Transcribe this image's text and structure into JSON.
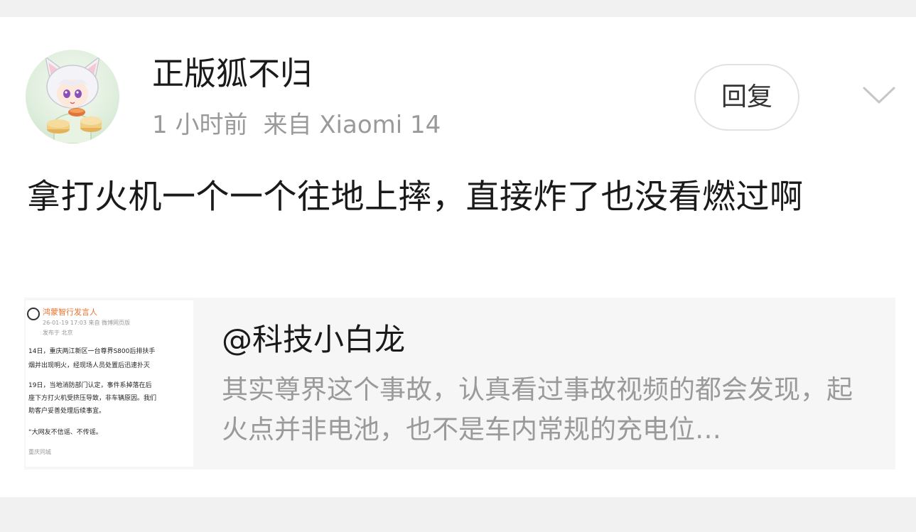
{
  "post": {
    "username": "正版狐不归",
    "time": "1 小时前",
    "source": "来自 Xiaomi 14",
    "reply_label": "回复",
    "content": "拿打火机一个一个往地上摔，直接炸了也没看燃过啊"
  },
  "quote": {
    "author": "@科技小白龙",
    "text": "其实尊界这个事故，认真看过事故视频的都会发现，起火点并非电池，也不是车内常规的充电位…",
    "thumbnail": {
      "author": "鸿蒙智行发言人",
      "date": "26-01-19 17:03 来自 微博网页版",
      "location": "发布于 北京",
      "lines": [
        "14日，重庆两江新区一台尊界S800后排扶手",
        "烟并出现明火，经现场人员处置后迅速扑灭",
        "19日，当地消防部门认定，事件系掉落在后",
        "座下方打火机受挤压导致，非车辆原因。我们",
        "助客户妥善处理后续事宜。",
        "“大网友不信谣、不传谣。",
        "重庆同城"
      ]
    }
  },
  "colors": {
    "background": "#f1f1f1",
    "card": "#ffffff",
    "primary_text": "#1a1a1a",
    "secondary_text": "#9a9a9a",
    "quote_bg": "#f6f6f6"
  },
  "icons": {
    "avatar": "fox-girl-avatar",
    "expand": "chevron-down-icon"
  }
}
